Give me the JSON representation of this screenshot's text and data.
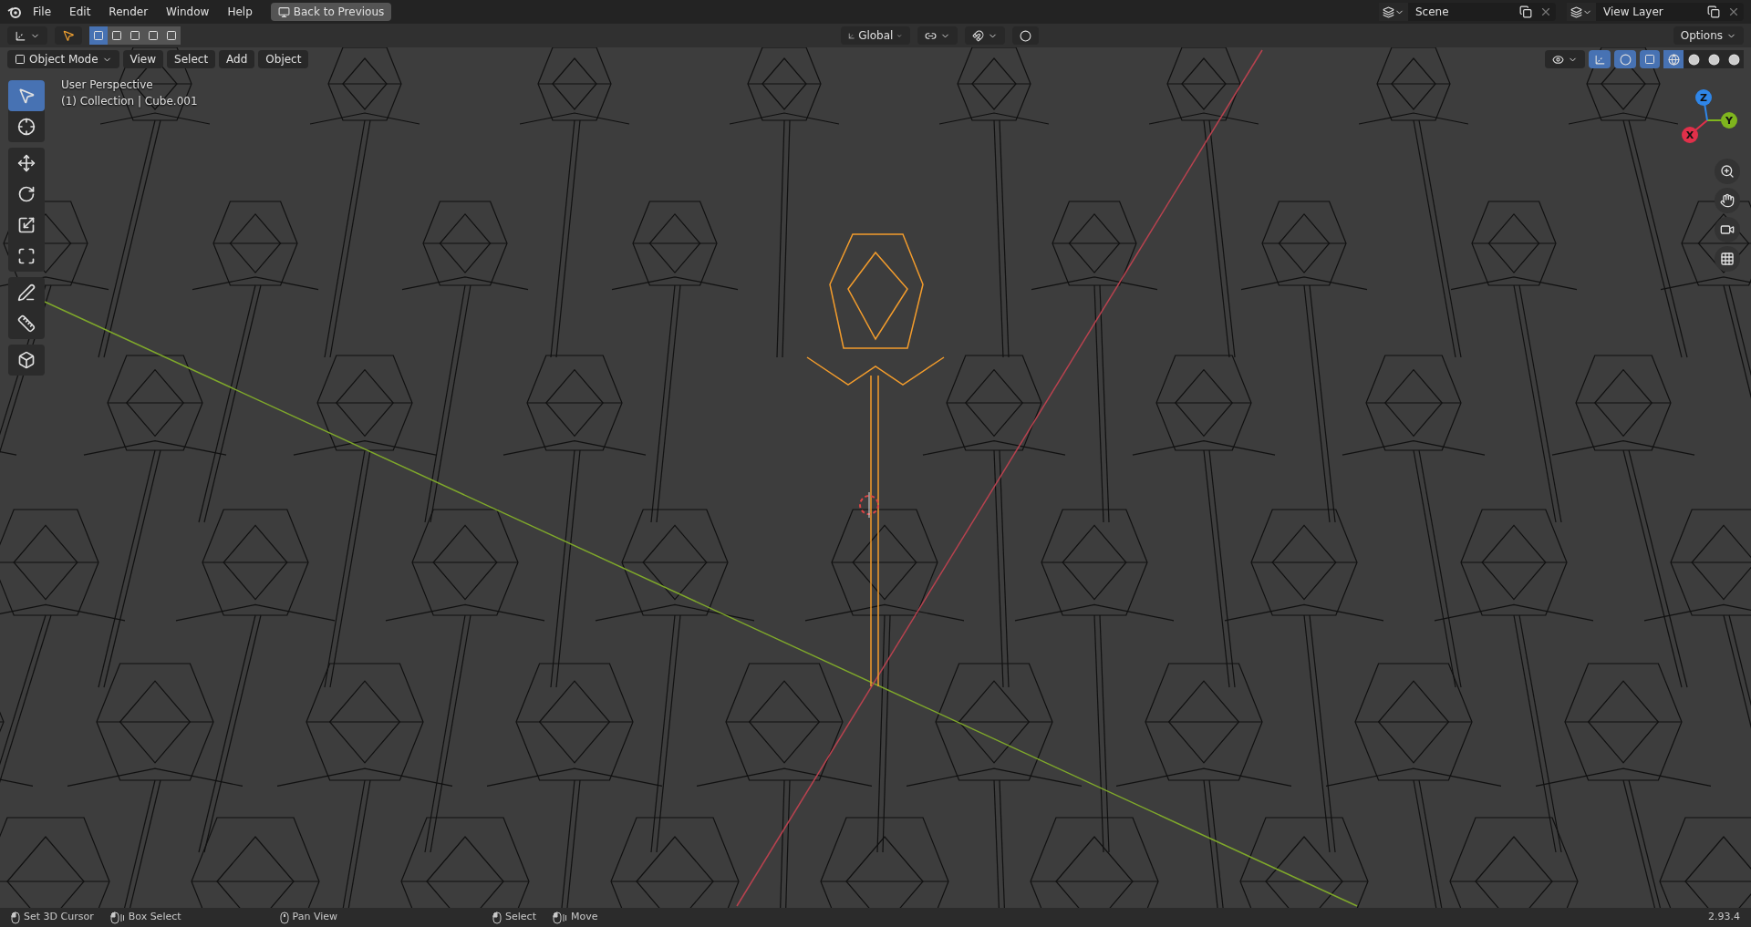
{
  "menu": [
    "File",
    "Edit",
    "Render",
    "Window",
    "Help"
  ],
  "back_button": "Back to Previous",
  "scene": {
    "name": "Scene"
  },
  "view_layer": {
    "name": "View Layer"
  },
  "select_modes": [
    {
      "selected": true
    },
    {
      "selected": false
    },
    {
      "selected": false
    },
    {
      "selected": false
    },
    {
      "selected": false
    }
  ],
  "transform_orientation": "Global",
  "options": "Options",
  "mode": "Object Mode",
  "view_menus": [
    "View",
    "Select",
    "Add",
    "Object"
  ],
  "viewport_info": [
    "User Perspective",
    "(1) Collection | Cube.001"
  ],
  "tool_groups": [
    [
      {
        "kind": "select",
        "selected": true
      },
      {
        "kind": "cursor",
        "selected": false
      }
    ],
    [
      {
        "kind": "move",
        "selected": false
      },
      {
        "kind": "rotate",
        "selected": false
      },
      {
        "kind": "scale",
        "selected": false
      },
      {
        "kind": "transform",
        "selected": false
      }
    ],
    [
      {
        "kind": "annotate",
        "selected": false
      },
      {
        "kind": "measure",
        "selected": false
      }
    ],
    [
      {
        "kind": "add-cube",
        "selected": false
      }
    ]
  ],
  "gizmos": {
    "on": true
  },
  "overlays": {
    "on": true
  },
  "xray": {
    "on": true
  },
  "shading_modes": [
    {
      "selected": true
    },
    {
      "selected": false
    },
    {
      "selected": false
    },
    {
      "selected": false
    }
  ],
  "gizmo_axes": [
    {
      "label": "X",
      "color": "#e0304a"
    },
    {
      "label": "Y",
      "color": "#7fb51e"
    },
    {
      "label": "Z",
      "color": "#2f86e8"
    }
  ],
  "status_hints": [
    {
      "kind": "left",
      "label": "Set 3D Cursor"
    },
    {
      "kind": "drag",
      "label": "Box Select"
    },
    {
      "kind": "middle",
      "label": "Pan View"
    },
    {
      "kind": "left",
      "label": "Select"
    },
    {
      "kind": "drag",
      "label": "Move"
    }
  ],
  "version": "2.93.4"
}
